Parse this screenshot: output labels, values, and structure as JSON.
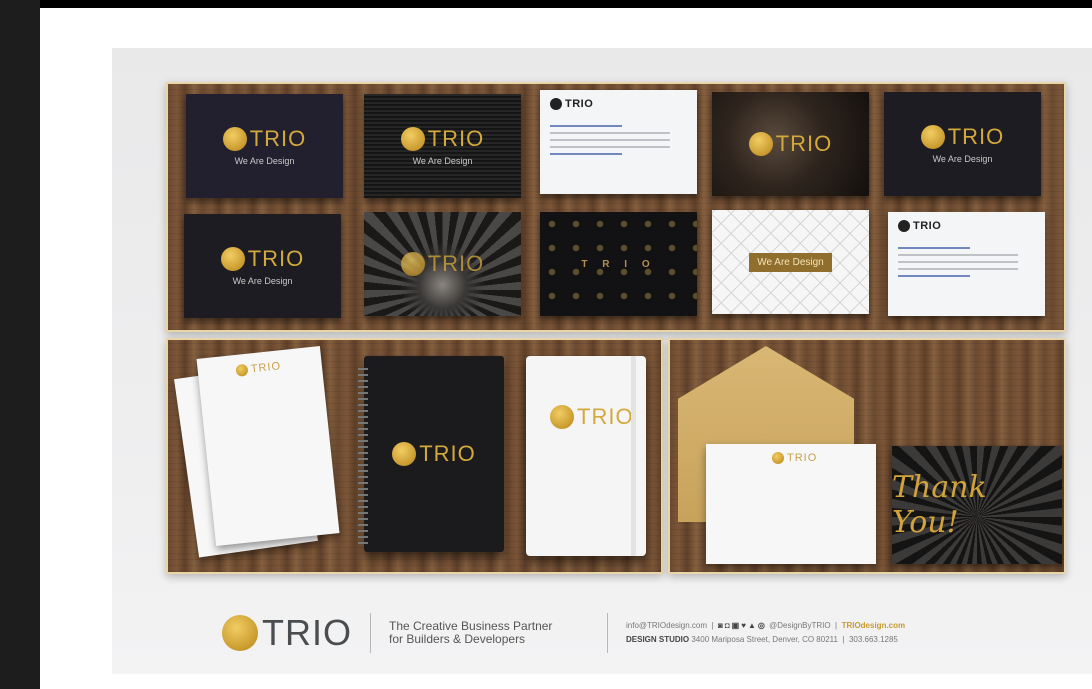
{
  "brand": {
    "name": "TRIO",
    "card_tagline": "We Are Design",
    "plate_text": "We Are Design",
    "pattern_text": "T R I O",
    "thank_you": "Thank You!"
  },
  "footer": {
    "logo_text": "TRIO",
    "tagline_line1": "The Creative Business Partner",
    "tagline_line2": "for Builders & Developers",
    "email": "info@TRIOdesign.com",
    "social_icons": "◙◘▣♥▲◎",
    "social_handle": "@DesignByTRIO",
    "website": "TRIOdesign.com",
    "studio_label": "DESIGN STUDIO",
    "address": "3400 Mariposa Street, Denver, CO 80211",
    "phone": "303.663.1285"
  },
  "colors": {
    "gold": "#d4a93c",
    "wood": "#6e4d33",
    "frame": "#e8d6a8"
  }
}
